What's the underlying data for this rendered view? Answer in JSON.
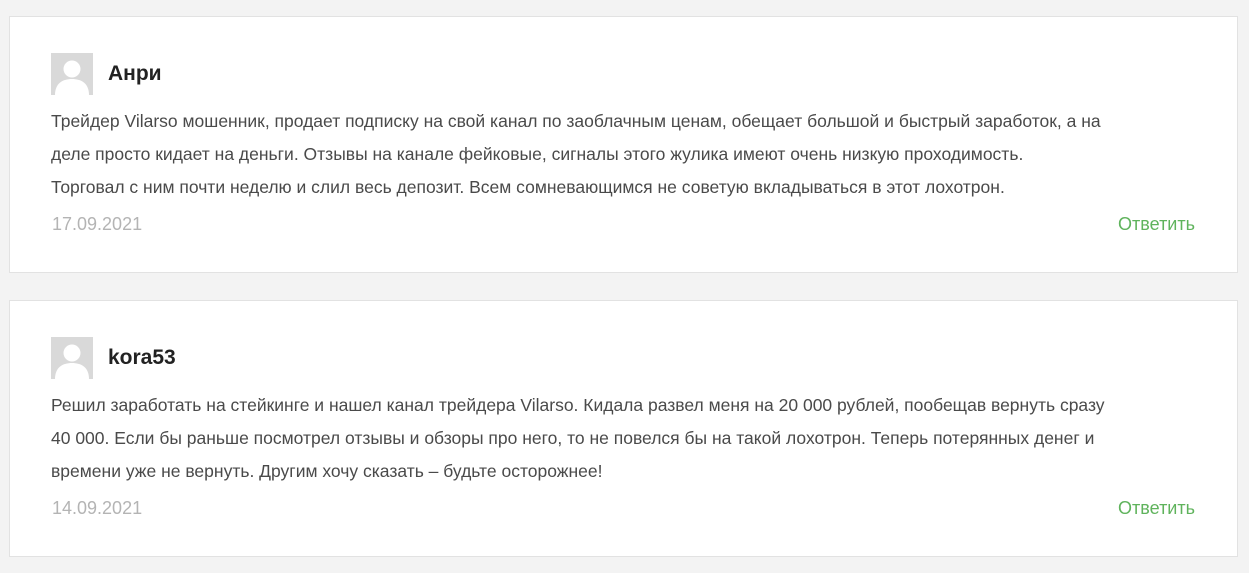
{
  "comments": [
    {
      "author": "Анри",
      "lines": [
        "Трейдер Vilarso мошенник, продает подписку на свой канал по заоблачным ценам, обещает большой и быстрый заработок, а на",
        "деле просто кидает на деньги. Отзывы на канале фейковые, сигналы этого жулика имеют очень низкую проходимость.",
        "Торговал с ним почти неделю и слил весь депозит. Всем сомневающимся не советую вкладываться в этот лохотрон."
      ],
      "date": "17.09.2021",
      "reply_label": "Ответить",
      "avatar_icon": "user-silhouette-icon"
    },
    {
      "author": "kora53",
      "lines": [
        "Решил заработать на стейкинге и нашел канал трейдера Vilarso. Кидала развел меня на 20 000 рублей, пообещав вернуть сразу",
        "40 000. Если бы раньше посмотрел отзывы и обзоры про него, то не повелся бы на такой лохотрон. Теперь потерянных денег и",
        "времени уже не вернуть. Другим хочу сказать – будьте осторожнее!"
      ],
      "date": "14.09.2021",
      "reply_label": "Ответить",
      "avatar_icon": "user-silhouette-icon"
    }
  ],
  "colors": {
    "background": "#f3f3f3",
    "card": "#ffffff",
    "reply_link": "#5fb35c",
    "date_text": "#b4b4b4",
    "body_text": "#4a4a4a"
  }
}
